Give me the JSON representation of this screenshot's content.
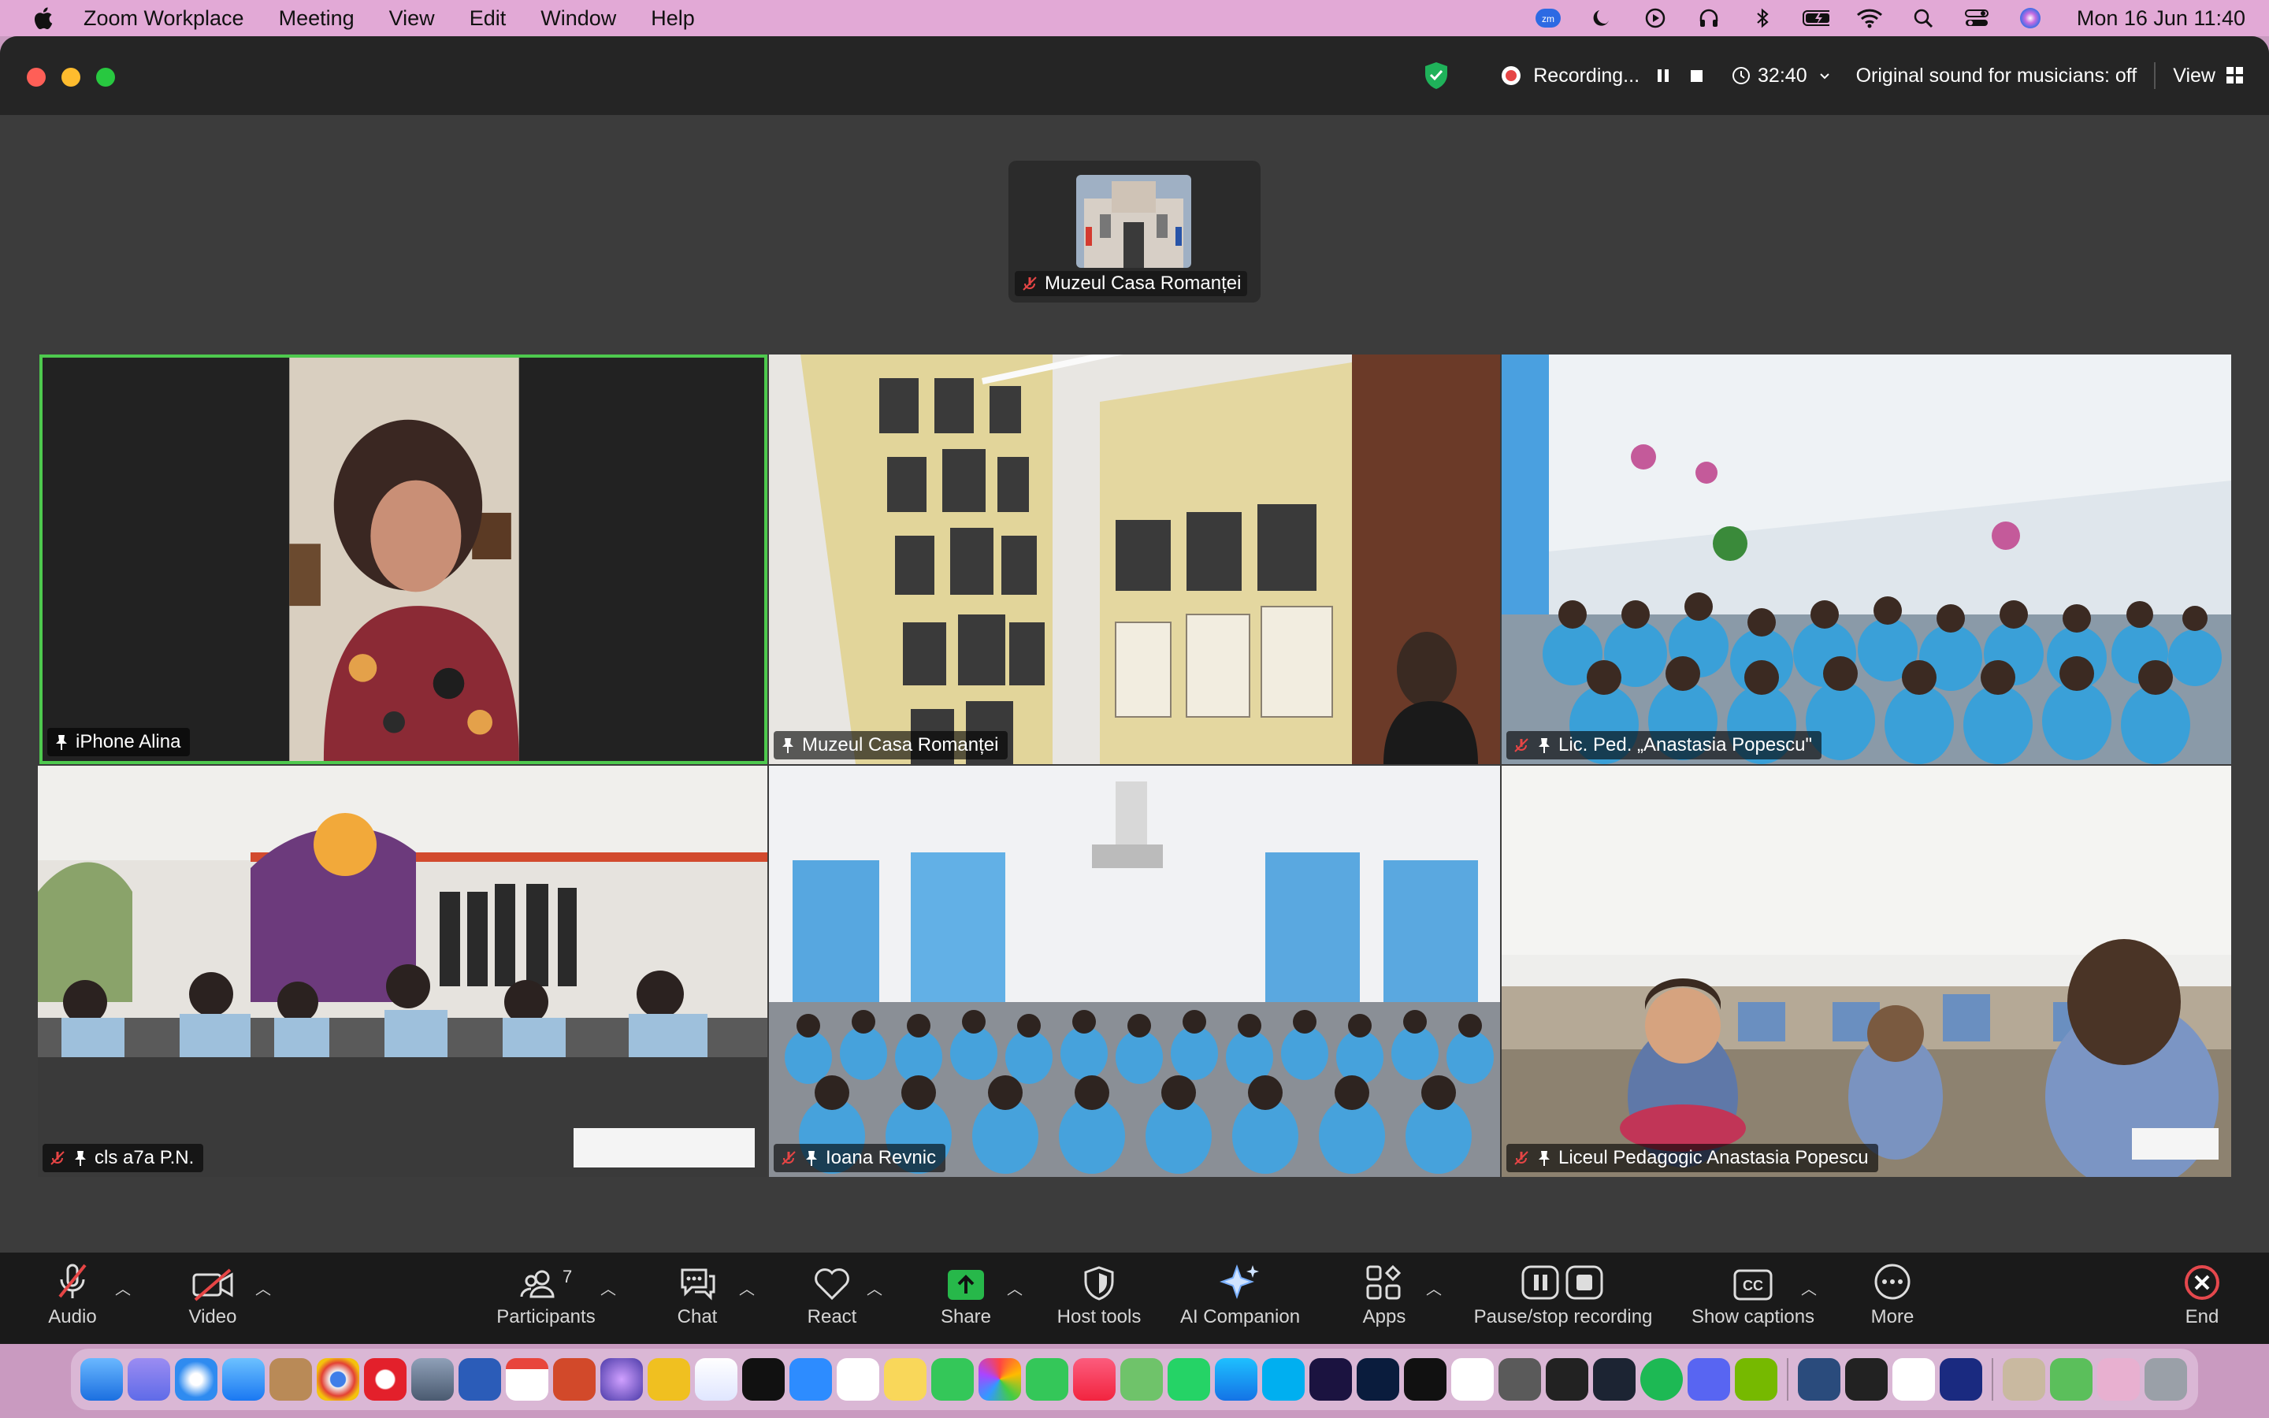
{
  "menubar": {
    "app_name": "Zoom Workplace",
    "items": [
      "Meeting",
      "View",
      "Edit",
      "Window",
      "Help"
    ],
    "status_icons": [
      "zoom-status-icon",
      "moon-icon",
      "play-circle-icon",
      "headphones-icon",
      "bluetooth-icon",
      "battery-icon",
      "wifi-icon",
      "search-icon",
      "control-center-icon",
      "siri-icon"
    ],
    "clock": "Mon 16 Jun  11:40"
  },
  "titlebar": {
    "recording_label": "Recording...",
    "timer": "32:40",
    "original_sound": "Original sound for musicians: off",
    "view_label": "View"
  },
  "thumbnail": {
    "name": "Muzeul Casa Romanței"
  },
  "participants": [
    {
      "name": "iPhone Alina",
      "muted": false,
      "active_speaker": true
    },
    {
      "name": "Muzeul Casa Romanței",
      "muted": false,
      "active_speaker": false
    },
    {
      "name": "Lic. Ped. „Anastasia Popescu\"",
      "muted": true,
      "active_speaker": false
    },
    {
      "name": "cls a7a P.N.",
      "muted": true,
      "active_speaker": false
    },
    {
      "name": "Ioana Revnic",
      "muted": true,
      "active_speaker": false
    },
    {
      "name": "Liceul Pedagogic Anastasia Popescu",
      "muted": true,
      "active_speaker": false
    }
  ],
  "toolbar": {
    "audio": "Audio",
    "video": "Video",
    "participants": "Participants",
    "participants_count": "7",
    "chat": "Chat",
    "react": "React",
    "share": "Share",
    "host_tools": "Host tools",
    "ai_companion": "AI Companion",
    "apps": "Apps",
    "pause_stop": "Pause/stop recording",
    "captions": "Show captions",
    "more": "More",
    "end": "End"
  },
  "colors": {
    "menubar": "#e2a9d6",
    "window_bg": "#3c3c3c",
    "active_speaker_border": "#4ec94e",
    "share_green": "#27b84a",
    "end_red": "#e5484d",
    "record_red": "#e64545"
  }
}
